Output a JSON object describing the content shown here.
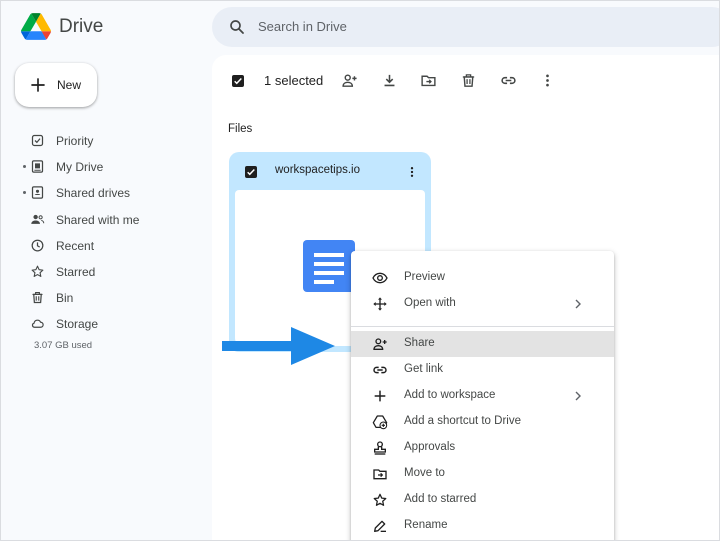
{
  "app": {
    "name": "Drive"
  },
  "search": {
    "placeholder": "Search in Drive"
  },
  "new_button": {
    "label": "New"
  },
  "sidebar": {
    "items": [
      {
        "label": "Priority",
        "icon": "priority-icon"
      },
      {
        "label": "My Drive",
        "icon": "my-drive-icon"
      },
      {
        "label": "Shared drives",
        "icon": "shared-drives-icon"
      },
      {
        "label": "Shared with me",
        "icon": "shared-with-me-icon"
      },
      {
        "label": "Recent",
        "icon": "recent-icon"
      },
      {
        "label": "Starred",
        "icon": "star-icon"
      },
      {
        "label": "Bin",
        "icon": "bin-icon"
      },
      {
        "label": "Storage",
        "icon": "cloud-icon"
      }
    ],
    "storage_used": "3.07 GB used"
  },
  "toolbar": {
    "selected_label": "1 selected",
    "actions": [
      "add-person-icon",
      "download-icon",
      "move-to-folder-icon",
      "bin-icon",
      "link-icon",
      "more-vert-icon"
    ]
  },
  "files": {
    "heading": "Files",
    "items": [
      {
        "name": "workspacetips.io",
        "type": "google-doc"
      }
    ]
  },
  "context_menu": {
    "items": [
      {
        "label": "Preview",
        "icon": "eye-icon"
      },
      {
        "label": "Open with",
        "icon": "open-with-icon",
        "submenu": true
      },
      {
        "label": "Share",
        "icon": "add-person-icon",
        "highlighted": true
      },
      {
        "label": "Get link",
        "icon": "link-icon"
      },
      {
        "label": "Add to workspace",
        "icon": "plus-icon",
        "submenu": true
      },
      {
        "label": "Add a shortcut to Drive",
        "icon": "add-shortcut-icon"
      },
      {
        "label": "Approvals",
        "icon": "approvals-icon"
      },
      {
        "label": "Move to",
        "icon": "move-to-folder-icon"
      },
      {
        "label": "Add to starred",
        "icon": "star-icon"
      },
      {
        "label": "Rename",
        "icon": "rename-icon"
      }
    ]
  },
  "colors": {
    "accent_blue": "#1a73e8",
    "card_selected": "#c2e7ff",
    "doc_blue": "#4285f4",
    "arrow_blue": "#1e88e5",
    "menu_highlight": "#e3e3e3"
  }
}
